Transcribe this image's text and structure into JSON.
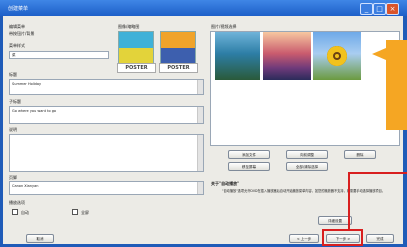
{
  "window": {
    "title": "创建菜单"
  },
  "fields": {
    "menu_title_label": "编辑菜单",
    "menu_title_value": "带按钮片/背景",
    "template_label": "菜单样式",
    "template_value": "菜",
    "title_label": "标题",
    "title_value": "Summer Holiday",
    "subtitle_label": "子标题",
    "subtitle_value": "Go where you want to go",
    "notes_label": "说明",
    "footer_label": "页脚",
    "footer_value": "Canon Xianyan"
  },
  "thumbnails": {
    "header": "图像/缩略图",
    "poster_labels": [
      "POSTER",
      "POSTER"
    ]
  },
  "images": {
    "header": "图片/视频选择"
  },
  "image_buttons": [
    "添加文件",
    "向前调整",
    "删除",
    "移至屏幕",
    "全部/清除选择"
  ],
  "checkboxes": {
    "group_label": "播放选项",
    "opt1": "自动",
    "opt2": "全屏"
  },
  "info": {
    "heading": "关于\"自动播放\"",
    "text": "\"自动播放\"选项允许DVD在插入播放器后自动开始播放菜单内容，如您的播放器不支持，则需要手动选择播放项目。"
  },
  "side_button": "详细设置",
  "buttons": {
    "back": "取消",
    "prev": "< 上一步",
    "next": "下一步 >",
    "cancel": "完成"
  },
  "colors": {
    "titlebar": "#1d5fc8",
    "highlight": "#d81f1f",
    "callout": "#f5a623"
  }
}
